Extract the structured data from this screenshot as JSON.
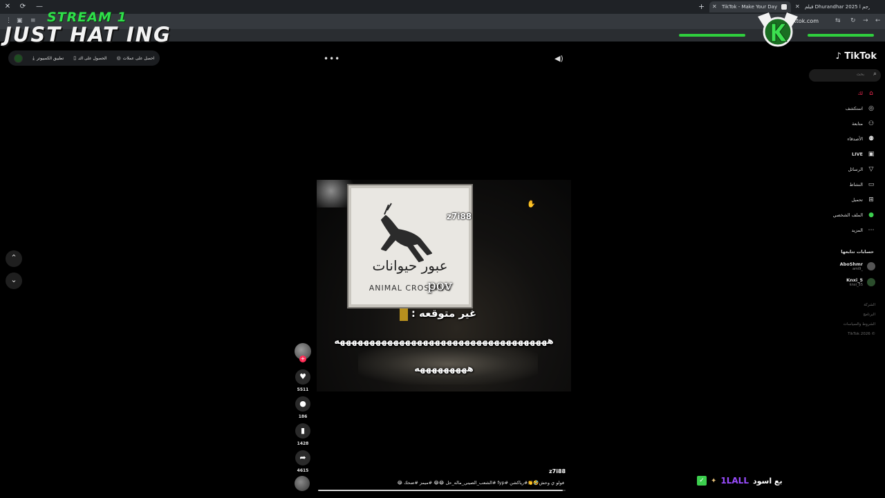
{
  "browser": {
    "tabs": [
      {
        "label": "TikTok - Make Your Day",
        "active": true
      },
      {
        "label": "فيلم Dhurandhar 2025 مترجم ا",
        "active": false
      }
    ],
    "url": "tiktok.com",
    "new_tab_symbol": "+",
    "window_buttons": [
      "✕",
      "⟳",
      "—"
    ]
  },
  "overlay": {
    "stream_label": "STREAM 1",
    "stream_title": "JUST HAT ING",
    "accent_color": "#2fe04a",
    "chat": {
      "user": "1LALL",
      "message": "بع اسود",
      "user_color": "#9a4dff"
    }
  },
  "subbar": {
    "items": [
      {
        "label": "احصل على عملات",
        "icon": "coin-icon"
      },
      {
        "label": "الحصول على التـ",
        "icon": "phone-icon"
      },
      {
        "label": "تطبيق الكمبيوتر",
        "icon": "download-icon"
      }
    ]
  },
  "video": {
    "sign_arabic": "عبور حيوانات",
    "sign_english": "ANIMAL CROSSING",
    "watermark": "z7i88",
    "caption_pov": "pov",
    "caption_line1": "غير متوقعه :",
    "caption_line2": "ههههههههههههههههههههههههههههههههههههه",
    "caption_line3": "هههههههههه",
    "progress": 0.99
  },
  "actions": {
    "likes": "5511",
    "comments": "186",
    "saves": "1428",
    "shares": "4615"
  },
  "post": {
    "author": "z7i88",
    "description": "فولو ي وحش🤣👏#رياكشن #fyp #الشعب_الصيني_ماله_حل 😂😂 #ميمز #ضحك 😂"
  },
  "sidebar": {
    "logo": "TikTok",
    "search_placeholder": "بحث",
    "nav": [
      {
        "label": "لك",
        "icon": "home-icon",
        "active": true
      },
      {
        "label": "استكشف",
        "icon": "compass-icon"
      },
      {
        "label": "متابعة",
        "icon": "user-follow-icon"
      },
      {
        "label": "الأصدقاء",
        "icon": "friends-icon"
      },
      {
        "label": "LIVE",
        "icon": "live-icon"
      },
      {
        "label": "الرسائل",
        "icon": "send-icon"
      },
      {
        "label": "النشاط",
        "icon": "activity-icon"
      },
      {
        "label": "تحميل",
        "icon": "upload-icon"
      },
      {
        "label": "الملف الشخصي",
        "icon": "profile-icon"
      },
      {
        "label": "المزيد",
        "icon": "more-icon"
      }
    ],
    "following_title": "حسابات تتابعها",
    "following": [
      {
        "name": "AboShmr",
        "handle": "ami9_"
      },
      {
        "name": "Knxi_5",
        "handle": "knxi_55"
      }
    ],
    "footer": [
      "الشركة",
      "البرنامج",
      "الشروط والسياسات",
      "TikTok 2026 ©"
    ]
  }
}
